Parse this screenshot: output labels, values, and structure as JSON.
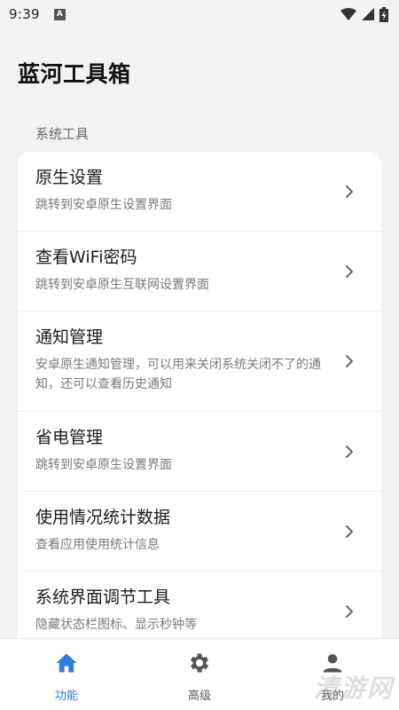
{
  "status_bar": {
    "time": "9:39",
    "notification_badge": "A",
    "icons": [
      "wifi-icon",
      "signal-icon",
      "battery-charging-icon"
    ]
  },
  "app_title": "蓝河工具箱",
  "section_label": "系统工具",
  "items": [
    {
      "title": "原生设置",
      "desc": "跳转到安卓原生设置界面"
    },
    {
      "title": "查看WiFi密码",
      "desc": "跳转到安卓原生互联网设置界面"
    },
    {
      "title": "通知管理",
      "desc": "安卓原生通知管理，可以用来关闭系统关闭不了的通知，还可以查看历史通知"
    },
    {
      "title": "省电管理",
      "desc": "跳转到安卓原生设置界面"
    },
    {
      "title": "使用情况统计数据",
      "desc": "查看应用使用统计信息"
    },
    {
      "title": "系统界面调节工具",
      "desc": "隐藏状态栏图标、显示秒钟等"
    }
  ],
  "bottom_nav": {
    "tabs": [
      {
        "label": "功能",
        "icon": "home-icon",
        "active": true
      },
      {
        "label": "高级",
        "icon": "gear-icon",
        "active": false
      },
      {
        "label": "我的",
        "icon": "person-icon",
        "active": false
      }
    ]
  },
  "watermark": "清游网",
  "colors": {
    "accent": "#2f7de1",
    "background": "#f1f2f4",
    "card": "#ffffff",
    "secondary_text": "#7a7a7a"
  }
}
